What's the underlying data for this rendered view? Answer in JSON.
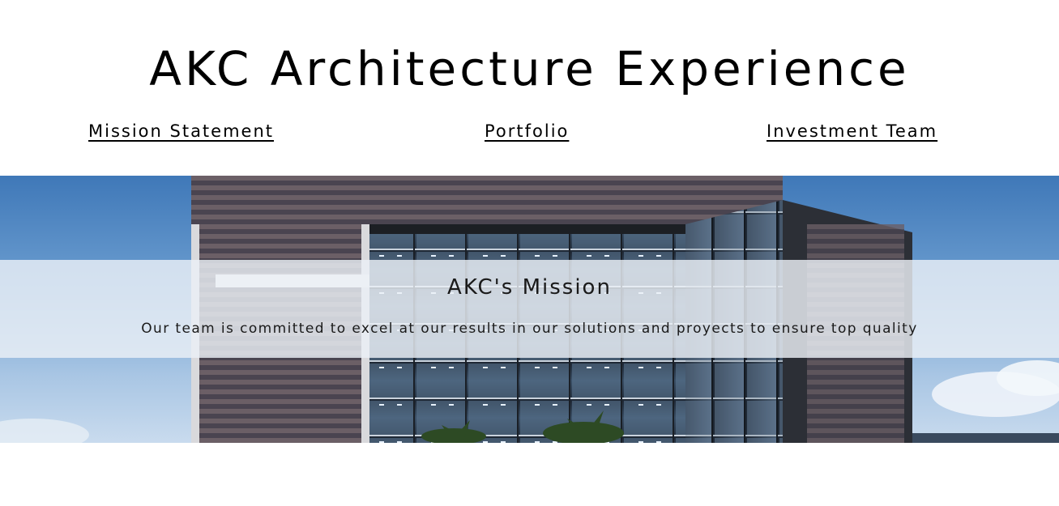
{
  "header": {
    "title": "AKC Architecture Experience"
  },
  "nav": {
    "items": [
      {
        "label": "Mission Statement"
      },
      {
        "label": "Portfolio"
      },
      {
        "label": "Investment Team"
      }
    ]
  },
  "hero": {
    "image": "modern-glass-office-building-photo",
    "sky_color": "#6a9ccf"
  },
  "mission": {
    "heading": "AKC's Mission",
    "text": "Our team is committed to excel at our results in our solutions and proyects to ensure top quality"
  }
}
